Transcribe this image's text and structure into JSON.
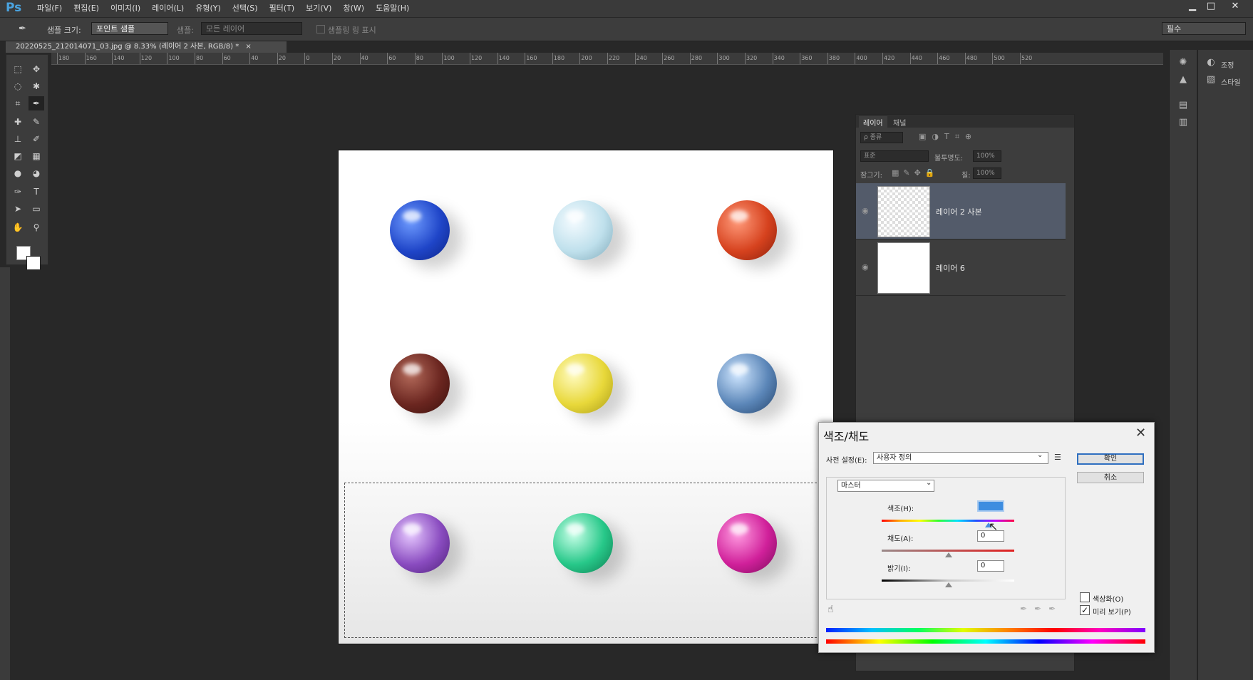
{
  "app": {
    "logo": "Ps",
    "menus": [
      "파일(F)",
      "편집(E)",
      "이미지(I)",
      "레이어(L)",
      "유형(Y)",
      "선택(S)",
      "필터(T)",
      "보기(V)",
      "창(W)",
      "도움말(H)"
    ]
  },
  "options_bar": {
    "sample_size_label": "샘플 크기:",
    "sample_size_value": "포인트 샘플",
    "sample_label": "샘플:",
    "sample_value": "모든 레이어",
    "show_ring_label": "샘플링 링 표시",
    "workspace_value": "필수"
  },
  "document_tab": {
    "title": "20220525_212014071_03.jpg @ 8.33% (레이어 2 사본, RGB/8) *",
    "close": "×"
  },
  "ruler": {
    "ticks": [
      "180",
      "160",
      "140",
      "120",
      "100",
      "80",
      "60",
      "40",
      "20",
      "0",
      "20",
      "40",
      "60",
      "80",
      "100",
      "120",
      "140",
      "160",
      "180",
      "200",
      "220",
      "240",
      "260",
      "280",
      "300",
      "320",
      "340",
      "360",
      "380",
      "400",
      "420",
      "440",
      "460",
      "480",
      "500",
      "520"
    ]
  },
  "right_strip": {
    "adjust_label": "조정",
    "style_label": "스타일"
  },
  "layers_panel": {
    "tab_layers": "레이어",
    "tab_channels": "채널",
    "filter_kind": "ρ 종류",
    "blend_mode": "표준",
    "opacity_label": "불투명도:",
    "opacity_value": "100%",
    "lock_label": "잠그기:",
    "fill_label": "칠:",
    "fill_value": "100%",
    "layers": [
      {
        "name": "레이어 2 사본",
        "selected": true
      },
      {
        "name": "레이어 6",
        "selected": false
      }
    ]
  },
  "dialog": {
    "title": "색조/채도",
    "close": "✕",
    "preset_label": "사전 설정(E):",
    "preset_value": "사용자 정의",
    "channel_value": "마스터",
    "hue_label": "색조(H):",
    "hue_value": "",
    "saturation_label": "채도(A):",
    "saturation_value": "0",
    "lightness_label": "밝기(I):",
    "lightness_value": "0",
    "ok_label": "확인",
    "cancel_label": "취소",
    "colorize_label": "색상화(O)",
    "colorize_checked": false,
    "preview_label": "미리 보기(P)",
    "preview_checked": true,
    "preview_mark": "✓"
  },
  "colors": {
    "accent": "#2f6fc0",
    "selected_layer": "#535b6a"
  }
}
